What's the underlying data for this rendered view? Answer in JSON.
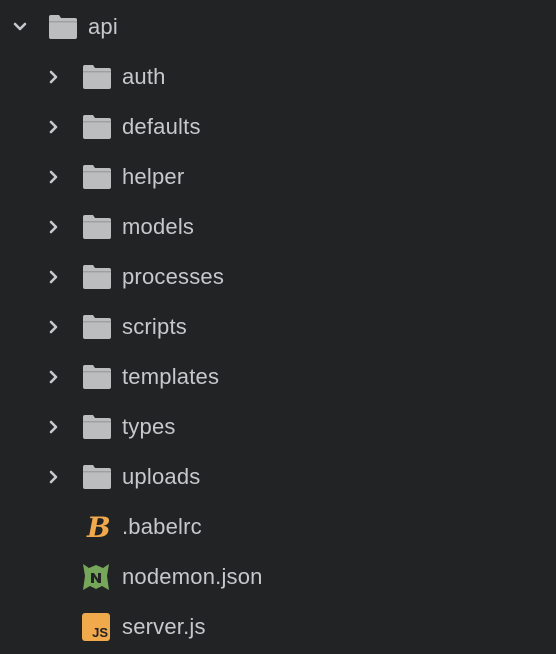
{
  "tree": {
    "root": {
      "name": "api",
      "expanded": true,
      "icon": "folder-icon"
    },
    "folders": [
      {
        "name": "auth",
        "expanded": false,
        "icon": "folder-icon"
      },
      {
        "name": "defaults",
        "expanded": false,
        "icon": "folder-icon"
      },
      {
        "name": "helper",
        "expanded": false,
        "icon": "folder-icon"
      },
      {
        "name": "models",
        "expanded": false,
        "icon": "folder-icon"
      },
      {
        "name": "processes",
        "expanded": false,
        "icon": "folder-icon"
      },
      {
        "name": "scripts",
        "expanded": false,
        "icon": "folder-icon"
      },
      {
        "name": "templates",
        "expanded": false,
        "icon": "folder-icon"
      },
      {
        "name": "types",
        "expanded": false,
        "icon": "folder-icon"
      },
      {
        "name": "uploads",
        "expanded": false,
        "icon": "folder-icon"
      }
    ],
    "files": [
      {
        "name": ".babelrc",
        "icon": "babel-icon",
        "icon_text": "B",
        "color": "#f0a94b"
      },
      {
        "name": "nodemon.json",
        "icon": "nodemon-icon",
        "color": "#76a65a"
      },
      {
        "name": "server.js",
        "icon": "javascript-icon",
        "icon_text": "JS",
        "color": "#f0a94b"
      }
    ]
  },
  "colors": {
    "background": "#222325",
    "text": "#c6c8cb",
    "folder": "#bcbdbf",
    "chevron": "#c6c8cb"
  }
}
